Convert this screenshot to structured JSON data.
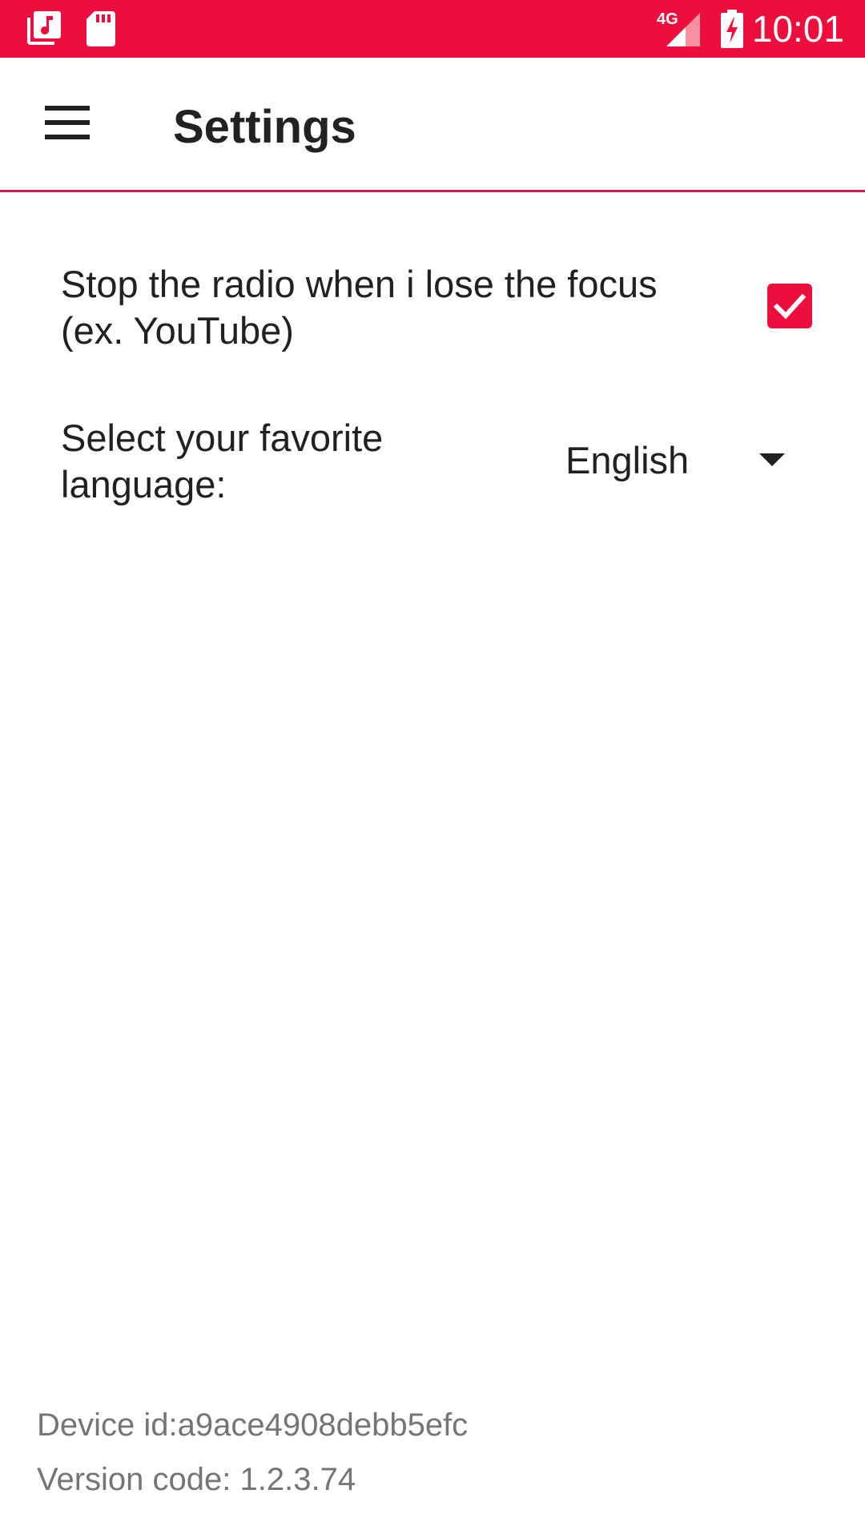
{
  "status_bar": {
    "time": "10:01",
    "network": "4G",
    "icons": [
      "music-library-icon",
      "sd-card-icon",
      "signal-4g-icon",
      "battery-charging-icon"
    ],
    "background_color": "#EC0E3C"
  },
  "app_bar": {
    "title": "Settings",
    "menu_icon": "hamburger-menu-icon",
    "divider_color": "#D8194A"
  },
  "settings": {
    "stop_on_focus_loss": {
      "label": "Stop the radio when i lose the focus (ex. YouTube)",
      "checked": true
    },
    "language": {
      "label": "Select your favorite language:",
      "selected": "English"
    }
  },
  "footer": {
    "device_id": "Device id:a9ace4908debb5efc",
    "version_code": "Version code: 1.2.3.74"
  },
  "colors": {
    "accent": "#EC0E3C",
    "text_primary": "#212121",
    "text_secondary": "#757575"
  }
}
